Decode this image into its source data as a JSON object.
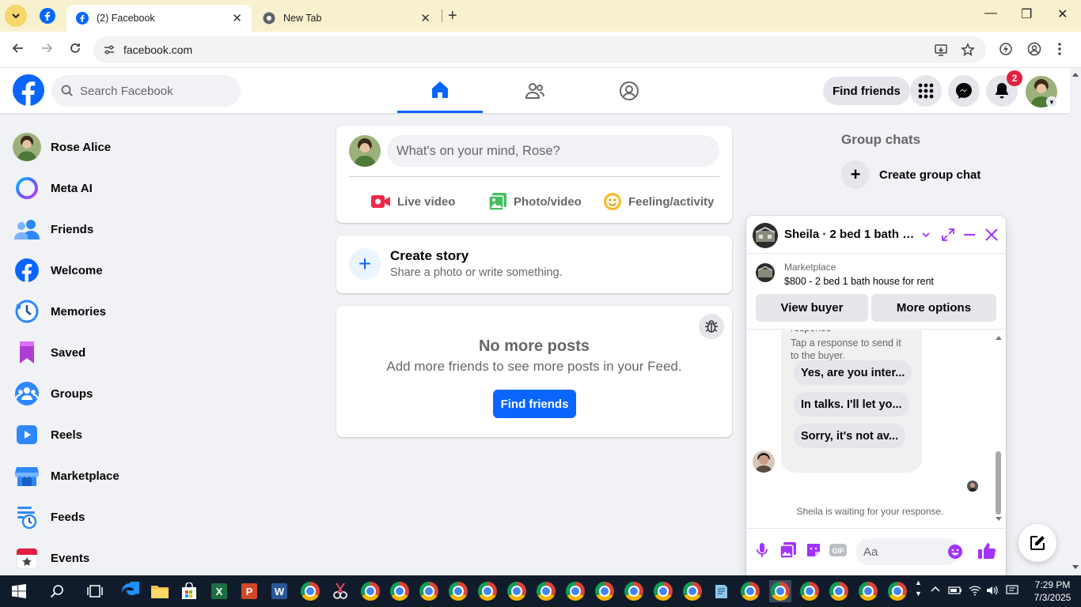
{
  "browser": {
    "tabs": [
      {
        "title": "(2) Facebook",
        "active": true
      },
      {
        "title": "New Tab",
        "active": false
      }
    ],
    "url": "facebook.com"
  },
  "header": {
    "search_placeholder": "Search Facebook",
    "find_friends": "Find friends",
    "notification_count": "2"
  },
  "sidebar": {
    "items": [
      {
        "label": "Rose Alice",
        "icon": "avatar"
      },
      {
        "label": "Meta AI",
        "icon": "meta-ai-icon"
      },
      {
        "label": "Friends",
        "icon": "friends-icon"
      },
      {
        "label": "Welcome",
        "icon": "facebook-icon"
      },
      {
        "label": "Memories",
        "icon": "clock-icon"
      },
      {
        "label": "Saved",
        "icon": "bookmark-icon"
      },
      {
        "label": "Groups",
        "icon": "groups-icon"
      },
      {
        "label": "Reels",
        "icon": "play-icon"
      },
      {
        "label": "Marketplace",
        "icon": "shop-icon"
      },
      {
        "label": "Feeds",
        "icon": "feeds-icon"
      },
      {
        "label": "Events",
        "icon": "calendar-star-icon"
      }
    ]
  },
  "composer": {
    "placeholder": "What's on your mind, Rose?",
    "live": "Live video",
    "photo": "Photo/video",
    "feeling": "Feeling/activity"
  },
  "story": {
    "title": "Create story",
    "subtitle": "Share a photo or write something."
  },
  "feed": {
    "heading": "No more posts",
    "message": "Add more friends to see more posts in your Feed.",
    "button": "Find friends"
  },
  "right": {
    "group_chats": "Group chats",
    "create_group_chat": "Create group chat"
  },
  "chat": {
    "title": "Sheila · 2 bed 1 bath h...",
    "marketplace_label": "Marketplace",
    "listing": "$800 - 2 bed 1 bath house for rent",
    "view_buyer": "View buyer",
    "more_options": "More options",
    "cut_text": "response",
    "hint": "Tap a response to send it to the buyer.",
    "quick_replies": [
      "Yes, are you inter...",
      "In talks. I'll let yo...",
      "Sorry, it's not av..."
    ],
    "waiting": "Sheila is waiting for your response.",
    "input_placeholder": "Aa"
  },
  "taskbar": {
    "time": "7:29 PM",
    "date": "7/3/2025"
  },
  "colors": {
    "brand": "#0866ff",
    "chat_accent": "#a033ff",
    "badge": "#e41e3f"
  }
}
